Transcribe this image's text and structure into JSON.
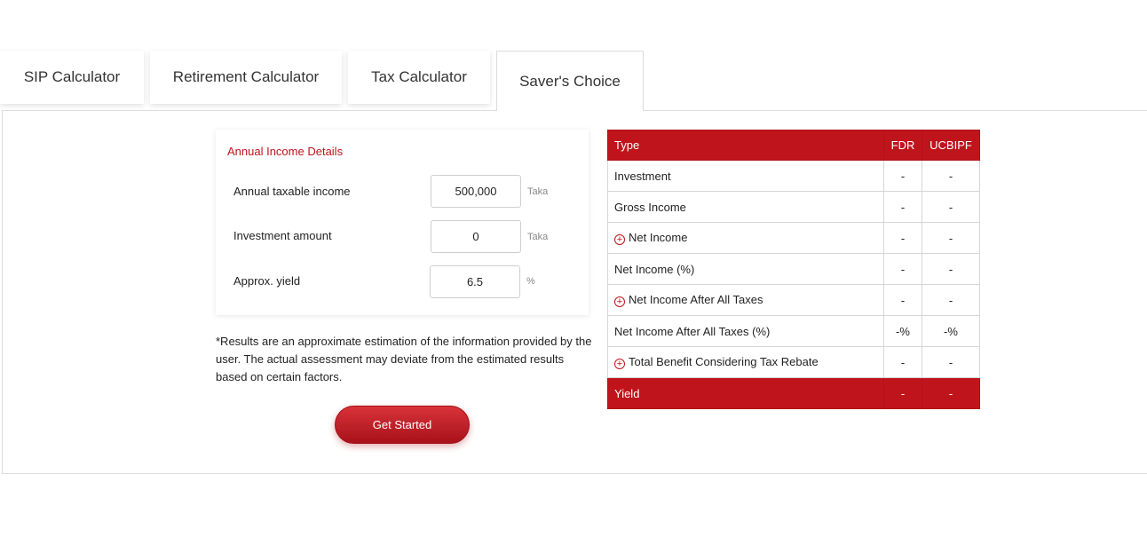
{
  "tabs": [
    {
      "label": "SIP Calculator"
    },
    {
      "label": "Retirement Calculator"
    },
    {
      "label": "Tax Calculator"
    },
    {
      "label": "Saver's Choice"
    }
  ],
  "income_card": {
    "title": "Annual Income Details",
    "fields": [
      {
        "label": "Annual taxable income",
        "value": "500,000",
        "unit": "Taka"
      },
      {
        "label": "Investment amount",
        "value": "0",
        "unit": "Taka"
      },
      {
        "label": "Approx. yield",
        "value": "6.5",
        "unit": "%"
      }
    ]
  },
  "disclaimer": "*Results are an approximate estimation of the information provided by the user. The actual assessment may deviate from the estimated results based on certain factors.",
  "get_started_label": "Get Started",
  "results_table": {
    "headers": [
      "Type",
      "FDR",
      "UCBIPF"
    ],
    "rows": [
      {
        "type": "Investment",
        "fdr": "-",
        "ucbipf": "-",
        "expandable": false
      },
      {
        "type": "Gross Income",
        "fdr": "-",
        "ucbipf": "-",
        "expandable": false
      },
      {
        "type": "Net Income",
        "fdr": "-",
        "ucbipf": "-",
        "expandable": true
      },
      {
        "type": "Net Income (%)",
        "fdr": "-",
        "ucbipf": "-",
        "expandable": false
      },
      {
        "type": "Net Income After All Taxes",
        "fdr": "-",
        "ucbipf": "-",
        "expandable": true
      },
      {
        "type": "Net Income After All Taxes (%)",
        "fdr": "-%",
        "ucbipf": "-%",
        "expandable": false
      },
      {
        "type": "Total Benefit Considering Tax Rebate",
        "fdr": "-",
        "ucbipf": "-",
        "expandable": true
      },
      {
        "type": "Yield",
        "fdr": "-",
        "ucbipf": "-",
        "expandable": false
      }
    ]
  },
  "icons": {
    "expand": "plus-circle-icon"
  },
  "colors": {
    "accent": "#c0141c",
    "button_gradient_top": "#d8323a",
    "button_gradient_bottom": "#a8121a"
  }
}
